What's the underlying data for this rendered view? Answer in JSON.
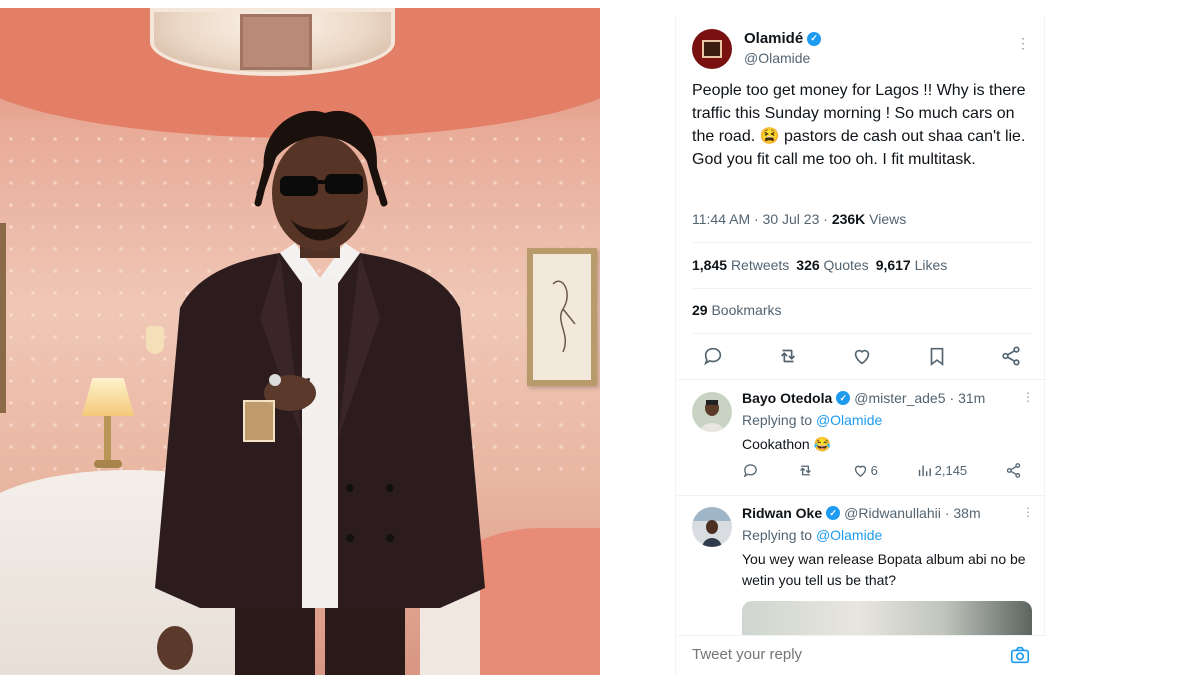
{
  "tweet": {
    "display_name": "Olamidé",
    "handle": "@Olamide",
    "verified_mark": "✓",
    "more_icon": "more-icon",
    "text": "People too get money for Lagos !! Why is there traffic this Sunday morning ! So much cars on the road. 😫 pastors de cash out shaa can't lie. God you fit call me too oh. I fit multitask.",
    "time_date": "11:44 AM · 30 Jul 23 · ",
    "views_count": "236K",
    "views_label": " Views",
    "retweets_count": "1,845",
    "retweets_label": "Retweets",
    "quotes_count": "326",
    "quotes_label": "Quotes",
    "likes_count": "9,617",
    "likes_label": "Likes",
    "bookmarks_count": "29",
    "bookmarks_label": "Bookmarks",
    "action_icons": [
      "reply-icon",
      "retweet-icon",
      "like-icon",
      "bookmark-icon",
      "share-icon"
    ]
  },
  "replies": [
    {
      "name": "Bayo Otedola",
      "handle": "@mister_ade5",
      "time": "· 31m",
      "replying_prefix": "Replying to ",
      "replying_to": "@Olamide",
      "text": "Cookathon 😂",
      "likes": "6",
      "views": "2,145"
    },
    {
      "name": "Ridwan Oke",
      "handle": "@Ridwanullahii",
      "time": "· 38m",
      "replying_prefix": "Replying to ",
      "replying_to": "@Olamide",
      "text": "You wey wan release Bopata album abi no be wetin you tell us be that?"
    }
  ],
  "reply_box": {
    "placeholder": "Tweet your reply",
    "camera_icon": "camera-icon"
  },
  "colors": {
    "accent": "#1d9bf0",
    "text_primary": "#0f1419",
    "text_secondary": "#536471"
  }
}
